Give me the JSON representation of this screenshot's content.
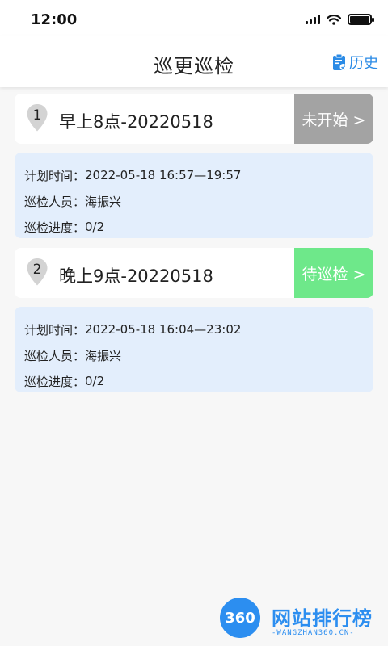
{
  "status_bar": {
    "time": "12:00"
  },
  "header": {
    "title": "巡更巡检",
    "history_label": "历史"
  },
  "tasks": [
    {
      "number": "1",
      "title": "早上8点-20220518",
      "status": "未开始 >",
      "status_color": "#a3a3a3",
      "details": [
        {
          "label": "计划时间：",
          "value": "2022-05-18 16:57—19:57"
        },
        {
          "label": "巡检人员：",
          "value": "海振兴"
        },
        {
          "label": "巡检进度：",
          "value": "0/2"
        }
      ]
    },
    {
      "number": "2",
      "title": "晚上9点-20220518",
      "status": "待巡检 >",
      "status_color": "#6ee88a",
      "details": [
        {
          "label": "计划时间：",
          "value": "2022-05-18 16:04—23:02"
        },
        {
          "label": "巡检人员：",
          "value": "海振兴"
        },
        {
          "label": "巡检进度：",
          "value": "0/2"
        }
      ]
    }
  ],
  "watermark": {
    "logo_text": "360",
    "name": "网站排行榜",
    "url": "-WANGZHAN360.CN-"
  },
  "colors": {
    "accent": "#2b8be6",
    "detail_bg": "#e3eefc"
  }
}
